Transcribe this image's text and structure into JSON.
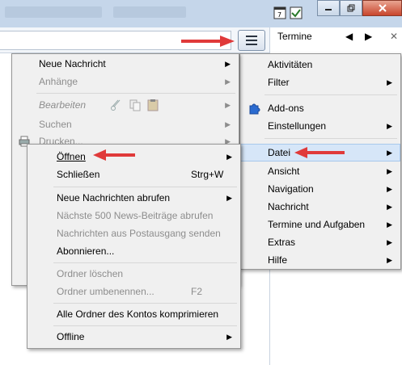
{
  "header": {
    "termine_label": "Termine",
    "prev_glyph": "◀",
    "next_glyph": "▶",
    "close_glyph": "✕",
    "menu_button_icon": "hamburger-icon"
  },
  "app_menu": {
    "items": [
      {
        "label": "Aktivitäten",
        "submenu": false,
        "icon": ""
      },
      {
        "label": "Filter",
        "submenu": true,
        "icon": ""
      },
      {
        "label": "Add-ons",
        "submenu": false,
        "icon": "puzzle-icon"
      },
      {
        "label": "Einstellungen",
        "submenu": true,
        "icon": ""
      },
      {
        "label": "Datei",
        "submenu": true,
        "icon": "",
        "highlighted": true
      },
      {
        "label": "Ansicht",
        "submenu": true,
        "icon": ""
      },
      {
        "label": "Navigation",
        "submenu": true,
        "icon": ""
      },
      {
        "label": "Nachricht",
        "submenu": true,
        "icon": ""
      },
      {
        "label": "Termine und Aufgaben",
        "submenu": true,
        "icon": ""
      },
      {
        "label": "Extras",
        "submenu": true,
        "icon": ""
      },
      {
        "label": "Hilfe",
        "submenu": true,
        "icon": ""
      }
    ]
  },
  "file_menu": {
    "items": [
      {
        "label": "Neue Nachricht",
        "submenu": true,
        "disabled": false
      },
      {
        "label": "Anhänge",
        "submenu": true,
        "disabled": true
      },
      {
        "label": "Bearbeiten",
        "submenu": true,
        "disabled": true
      },
      {
        "label": "Suchen",
        "submenu": true,
        "disabled": true
      },
      {
        "label": "Drucken...",
        "submenu": true,
        "disabled": true
      }
    ]
  },
  "open_menu": {
    "items": [
      {
        "label": "Öffnen",
        "submenu": true,
        "disabled": false,
        "shortcut": ""
      },
      {
        "label": "Schließen",
        "submenu": false,
        "disabled": false,
        "shortcut": "Strg+W"
      },
      {
        "label": "Neue Nachrichten abrufen",
        "submenu": true,
        "disabled": false,
        "shortcut": ""
      },
      {
        "label": "Nächste 500 News-Beiträge abrufen",
        "submenu": false,
        "disabled": true,
        "shortcut": ""
      },
      {
        "label": "Nachrichten aus Postausgang senden",
        "submenu": false,
        "disabled": true,
        "shortcut": ""
      },
      {
        "label": "Abonnieren...",
        "submenu": false,
        "disabled": false,
        "shortcut": ""
      },
      {
        "label": "Ordner löschen",
        "submenu": false,
        "disabled": true,
        "shortcut": ""
      },
      {
        "label": "Ordner umbenennen...",
        "submenu": false,
        "disabled": true,
        "shortcut": "F2"
      },
      {
        "label": "Alle Ordner des Kontos komprimieren",
        "submenu": false,
        "disabled": false,
        "shortcut": ""
      },
      {
        "label": "Offline",
        "submenu": true,
        "disabled": false,
        "shortcut": ""
      }
    ]
  },
  "colors": {
    "highlight": "#d6e6f8",
    "annotation_arrow": "#e03a3a",
    "menu_bg": "#f0f0f0"
  }
}
